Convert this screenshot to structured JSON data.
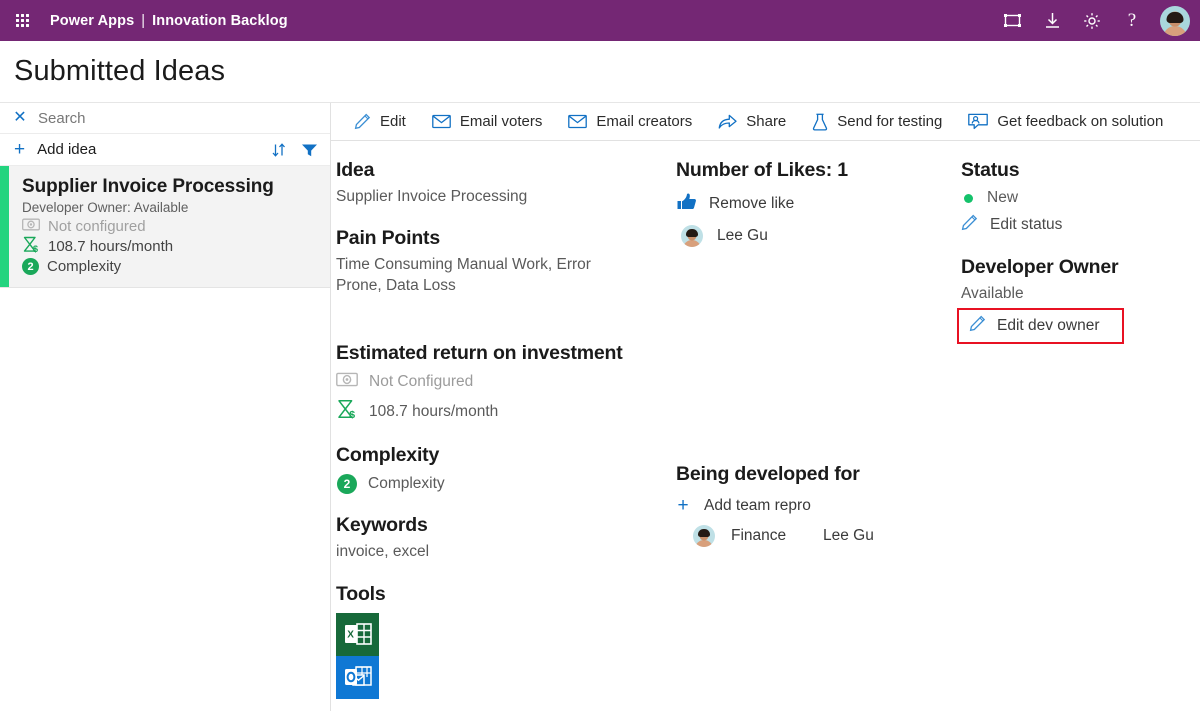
{
  "topbar": {
    "waffle_icon": "waffle-grid-icon",
    "brand": "Power Apps",
    "separator": "|",
    "app_name": "Innovation Backlog",
    "icons": [
      {
        "name": "fit-to-screen-icon",
        "label": "Fit to screen"
      },
      {
        "name": "download-icon",
        "label": "Download"
      },
      {
        "name": "settings-gear-icon",
        "label": "Settings"
      },
      {
        "name": "help-icon",
        "label": "?"
      }
    ],
    "avatar_alt": "User avatar"
  },
  "page": {
    "title": "Submitted Ideas"
  },
  "sidebar": {
    "search": {
      "clear_icon": "close-icon",
      "placeholder": "Search",
      "value": ""
    },
    "add": {
      "plus_icon": "plus-icon",
      "label": "Add idea",
      "sort_icon": "sort-icon",
      "filter_icon": "filter-icon"
    },
    "items": [
      {
        "title": "Supplier Invoice Processing",
        "subtitle": "Developer Owner: Available",
        "roi_text": "Not configured",
        "roi_icon": "money-icon",
        "hours_text": "108.7 hours/month",
        "hours_icon": "hourglass-dollar-icon",
        "complexity_badge": "2",
        "complexity_text": "Complexity",
        "accent_color": "#23d47f"
      }
    ]
  },
  "commandbar": {
    "commands": [
      {
        "label": "Edit",
        "icon": "pencil-icon"
      },
      {
        "label": "Email voters",
        "icon": "envelope-icon"
      },
      {
        "label": "Email creators",
        "icon": "envelope-icon"
      },
      {
        "label": "Share",
        "icon": "share-icon"
      },
      {
        "label": "Send for testing",
        "icon": "flask-icon"
      },
      {
        "label": "Get feedback on solution",
        "icon": "feedback-person-icon"
      }
    ]
  },
  "detail": {
    "idea": {
      "heading": "Idea",
      "value": "Supplier Invoice Processing"
    },
    "pain_points": {
      "heading": "Pain Points",
      "value": "Time Consuming Manual Work, Error Prone, Data Loss"
    },
    "roi": {
      "heading": "Estimated return on investment",
      "money_icon": "money-icon",
      "money_value": "Not Configured",
      "hours_icon": "hourglass-dollar-icon",
      "hours_value": "108.7 hours/month"
    },
    "complexity": {
      "heading": "Complexity",
      "badge": "2",
      "value": "Complexity"
    },
    "keywords": {
      "heading": "Keywords",
      "value": "invoice, excel"
    },
    "tools": {
      "heading": "Tools",
      "items": [
        {
          "name": "excel-icon",
          "label": "Excel",
          "color": "#17693a"
        },
        {
          "name": "outlook-icon",
          "label": "Outlook",
          "color": "#0f78d4"
        }
      ]
    },
    "likes": {
      "heading": "Number of Likes: 1",
      "action_icon": "thumbs-up-icon",
      "action_label": "Remove like",
      "voters": [
        {
          "name": "Lee Gu",
          "avatar": "avatar"
        }
      ]
    },
    "developed_for": {
      "heading": "Being developed for",
      "add_icon": "plus-icon",
      "add_label": "Add team repro",
      "rows": [
        {
          "avatar": "avatar",
          "team": "Finance",
          "person": "Lee Gu"
        }
      ]
    },
    "status": {
      "heading": "Status",
      "dot_color": "#15c26b",
      "value": "New",
      "edit_icon": "pencil-icon",
      "edit_label": "Edit status"
    },
    "developer_owner": {
      "heading": "Developer Owner",
      "value": "Available",
      "edit_icon": "pencil-icon",
      "edit_label": "Edit dev owner",
      "highlight_color": "#e81123"
    }
  }
}
